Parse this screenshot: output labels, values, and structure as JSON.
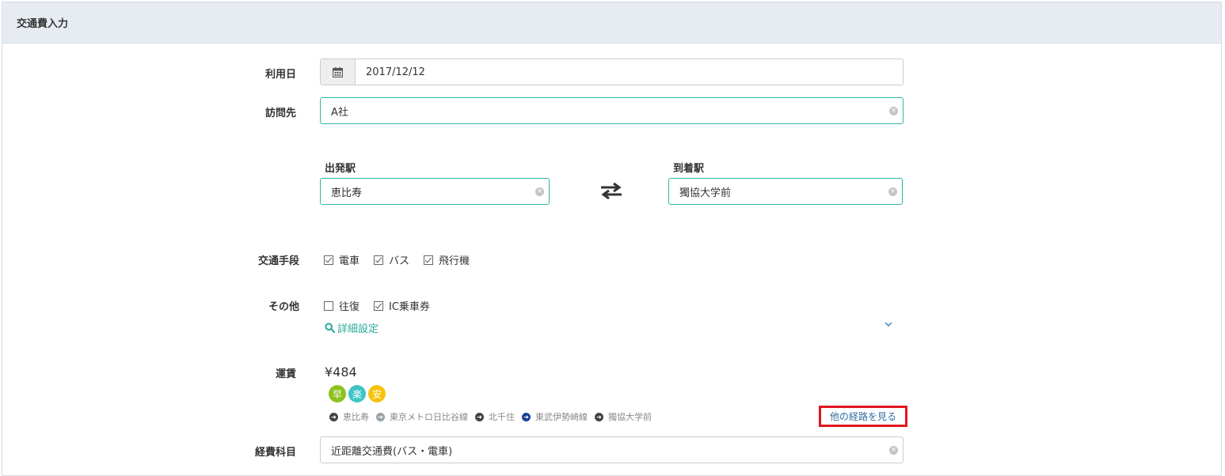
{
  "panel": {
    "title": "交通費入力"
  },
  "date": {
    "label": "利用日",
    "value": "2017/12/12",
    "icon": "calendar-icon"
  },
  "visit": {
    "label": "訪問先",
    "value": "A社"
  },
  "departure": {
    "label": "出発駅",
    "value": "恵比寿"
  },
  "arrival": {
    "label": "到着駅",
    "value": "獨協大学前"
  },
  "transport": {
    "label": "交通手段",
    "options": [
      {
        "label": "電車",
        "checked": true
      },
      {
        "label": "バス",
        "checked": true
      },
      {
        "label": "飛行機",
        "checked": true
      }
    ]
  },
  "other": {
    "label": "その他",
    "options": [
      {
        "label": "往復",
        "checked": false
      },
      {
        "label": "IC乗車券",
        "checked": true
      }
    ],
    "detail_link": "詳細設定"
  },
  "fare": {
    "label": "運賃",
    "value": "¥484",
    "badges": [
      {
        "text": "早",
        "color": "#8cc11f"
      },
      {
        "text": "楽",
        "color": "#3ec4c4"
      },
      {
        "text": "安",
        "color": "#f5c20e"
      }
    ],
    "route": [
      {
        "text": "恵比寿",
        "color": "#444444"
      },
      {
        "text": "東京メトロ日比谷線",
        "color": "#9aa3a8"
      },
      {
        "text": "北千住",
        "color": "#444444"
      },
      {
        "text": "東武伊勢崎線",
        "color": "#1d3f9a"
      },
      {
        "text": "獨協大学前",
        "color": "#444444"
      }
    ],
    "other_routes_link": "他の経路を見る"
  },
  "expense": {
    "label": "経費科目",
    "value": "近距離交通費(バス・電車)"
  }
}
